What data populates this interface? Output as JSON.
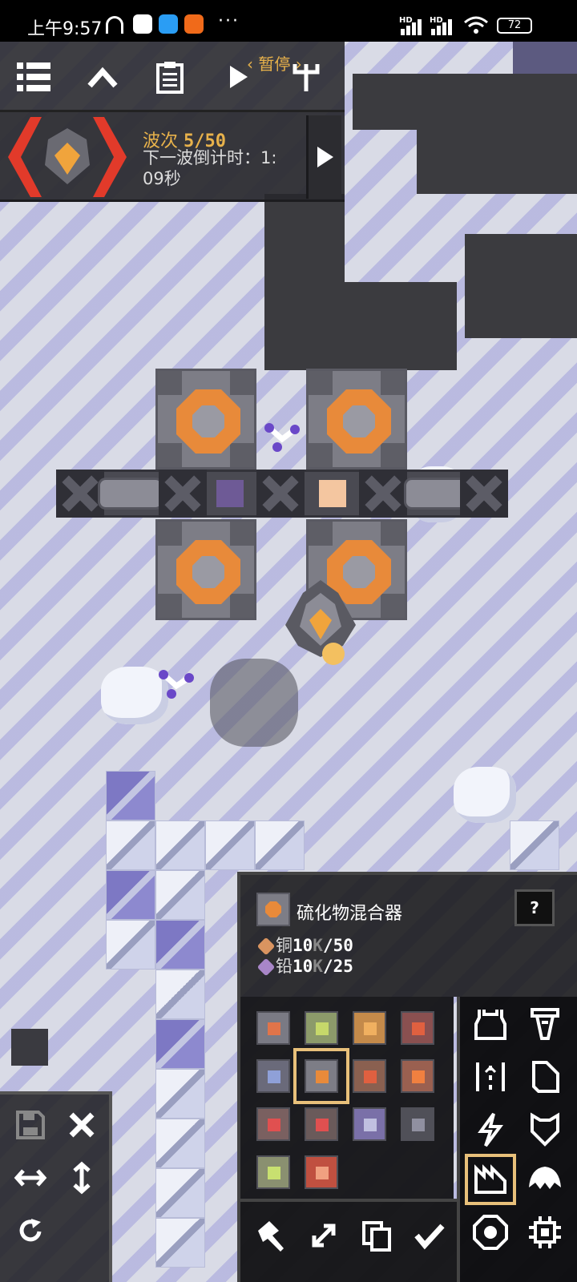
{
  "status_bar": {
    "time": "上午9:57",
    "more": "···",
    "battery": "72",
    "signal1_label": "HD",
    "signal2_label": "HD"
  },
  "hud": {
    "pause_label": "‹ 暂停 ›",
    "wave_label": "波次",
    "wave_value": "5/50",
    "countdown_label": "下一波倒计时：1:",
    "countdown_value": "09秒"
  },
  "block_info": {
    "name": "硫化物混合器",
    "help": "?",
    "costs": [
      {
        "resource": "铜",
        "amount": "10",
        "unit": "K",
        "required": "/50",
        "color": "#d99460"
      },
      {
        "resource": "铅",
        "amount": "10",
        "unit": "K",
        "required": "/25",
        "color": "#a886c8"
      }
    ]
  },
  "colors": {
    "accent": "#e8b24b",
    "selection": "#e8c07a",
    "enemy_red": "#e23a2a"
  },
  "block_grid": [
    {
      "icon": "block-1-icon",
      "color": "#7a7a84",
      "accent": "#e0744a"
    },
    {
      "icon": "block-2-icon",
      "color": "#8c9a6a",
      "accent": "#c6d86a"
    },
    {
      "icon": "block-3-icon",
      "color": "#c48a4a",
      "accent": "#f0b060"
    },
    {
      "icon": "block-4-icon",
      "color": "#8a5050",
      "accent": "#e06040"
    },
    {
      "icon": "block-5-icon",
      "color": "#6a6a7a",
      "accent": "#8fa0d8"
    },
    {
      "icon": "block-6-icon",
      "color": "#7d7d86",
      "accent": "#e88a3a"
    },
    {
      "icon": "block-7-icon",
      "color": "#8a6050",
      "accent": "#e06040"
    },
    {
      "icon": "block-8-icon",
      "color": "#9a6050",
      "accent": "#f08040"
    },
    {
      "icon": "block-9-icon",
      "color": "#7a6060",
      "accent": "#e05050"
    },
    {
      "icon": "block-10-icon",
      "color": "#6a5a5a",
      "accent": "#e05050"
    },
    {
      "icon": "block-11-icon",
      "color": "#7a70a8",
      "accent": "#c0c0e0"
    },
    {
      "icon": "block-12-icon",
      "color": "#505058",
      "accent": "#9090a0"
    },
    {
      "icon": "block-13-icon",
      "color": "#8a9070",
      "accent": "#c8e070"
    },
    {
      "icon": "block-14-icon",
      "color": "#c05040",
      "accent": "#f0a080"
    }
  ],
  "categories": [
    {
      "name": "turret-category",
      "icon": "turret-icon"
    },
    {
      "name": "production-category",
      "icon": "drill-icon"
    },
    {
      "name": "distribution-category",
      "icon": "conveyor-icon"
    },
    {
      "name": "liquid-category",
      "icon": "liquid-icon"
    },
    {
      "name": "power-category",
      "icon": "power-icon"
    },
    {
      "name": "defense-category",
      "icon": "shield-icon"
    },
    {
      "name": "crafting-category",
      "icon": "factory-icon"
    },
    {
      "name": "units-category",
      "icon": "unit-icon"
    },
    {
      "name": "effect-category",
      "icon": "core-icon"
    },
    {
      "name": "logic-category",
      "icon": "logic-icon"
    }
  ]
}
